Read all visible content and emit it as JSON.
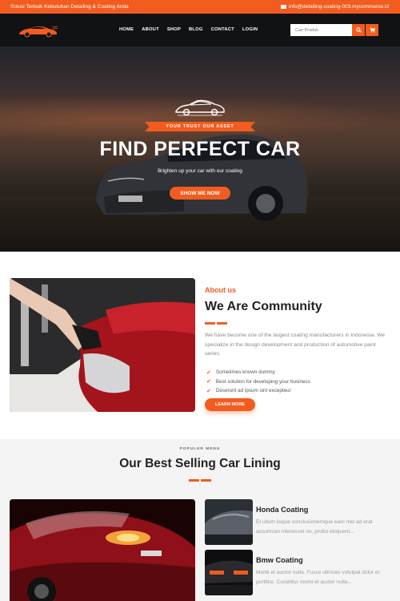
{
  "topbar": {
    "tagline": "Solusi Terbaik Kebutuhan Detailing & Coating Anda",
    "email": "info@detailing-coating-003.mycommerce.id"
  },
  "navbar": {
    "items": [
      "HOME",
      "ABOUT",
      "SHOP",
      "BLOG",
      "CONTACT",
      "LOGIN"
    ],
    "search_placeholder": "Cari Produk"
  },
  "hero": {
    "ribbon": "YOUR TRUST OUR ASSET",
    "title": "FIND PERFECT CAR",
    "subtitle": "Brighten up your car with our coating",
    "cta": "SHOW ME NOW"
  },
  "about": {
    "label": "About us",
    "title": "We Are Community",
    "text": "We have become one of the largest coating manufacturers in Indonesia. We specialize in the design development and production of automotive paint series.",
    "bullets": [
      "Sometimes known dummy",
      "Best solution for developing your business",
      "Deserunt ad ipsum sint excepteur"
    ],
    "button": "LEARN MORE"
  },
  "menu": {
    "kicker": "POPULER MENU",
    "title": "Our Best Selling Car Lining",
    "items": [
      {
        "name": "Honda Coating",
        "desc": "Et ullum iisque conclusionemque eam mel ad erat accumsan interesset no, probo eloquent..."
      },
      {
        "name": "Bmw Coating",
        "desc": "Morbi et auctor nulla. Fusce ultricies volutpat dolor et porttitor. Curabitur morbi et auctor nulla..."
      }
    ]
  },
  "colors": {
    "accent": "#f25c1f",
    "nav_bg": "#111214"
  }
}
